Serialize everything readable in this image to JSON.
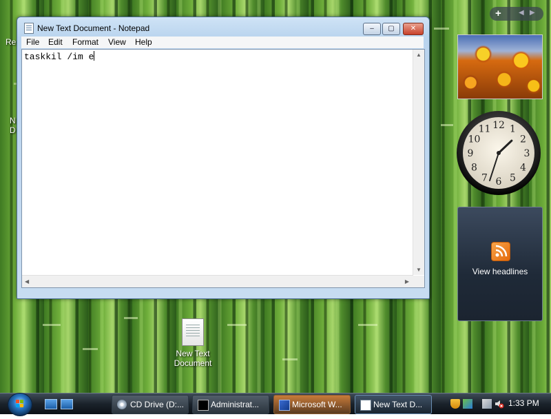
{
  "desktop": {
    "icons": [
      {
        "label_line1": "New Text",
        "label_line2": "Document"
      }
    ],
    "partial_labels": [
      "Re",
      "N",
      "D"
    ]
  },
  "notepad": {
    "title": "New Text Document - Notepad",
    "menu": [
      "File",
      "Edit",
      "Format",
      "View",
      "Help"
    ],
    "content": "taskkil /im e",
    "caption_buttons": {
      "minimize": "–",
      "maximize": "▢",
      "close": "✕"
    },
    "scroll_arrows": {
      "up": "▲",
      "down": "▼",
      "left": "◀",
      "right": "▶"
    }
  },
  "sidebar": {
    "controls": {
      "add": "+",
      "prev": "◀",
      "next": "▶"
    },
    "clock": {
      "numbers": [
        "12",
        "1",
        "2",
        "3",
        "4",
        "5",
        "6",
        "7",
        "8",
        "9",
        "10",
        "11"
      ],
      "hour": 1,
      "minute": 33
    },
    "news": {
      "label": "View headlines"
    }
  },
  "taskbar": {
    "tasks": [
      {
        "label": "CD Drive (D:...",
        "icon": "cd-drive-icon"
      },
      {
        "label": "Administrat...",
        "icon": "command-prompt-icon"
      },
      {
        "label": "Microsoft W...",
        "icon": "word-icon"
      },
      {
        "label": "New Text D...",
        "icon": "notepad-icon"
      }
    ],
    "clock": "1:33 PM"
  },
  "colors": {
    "accent": "#2a78c6",
    "close_button": "#c8412a",
    "rss": "#e46a0c"
  }
}
